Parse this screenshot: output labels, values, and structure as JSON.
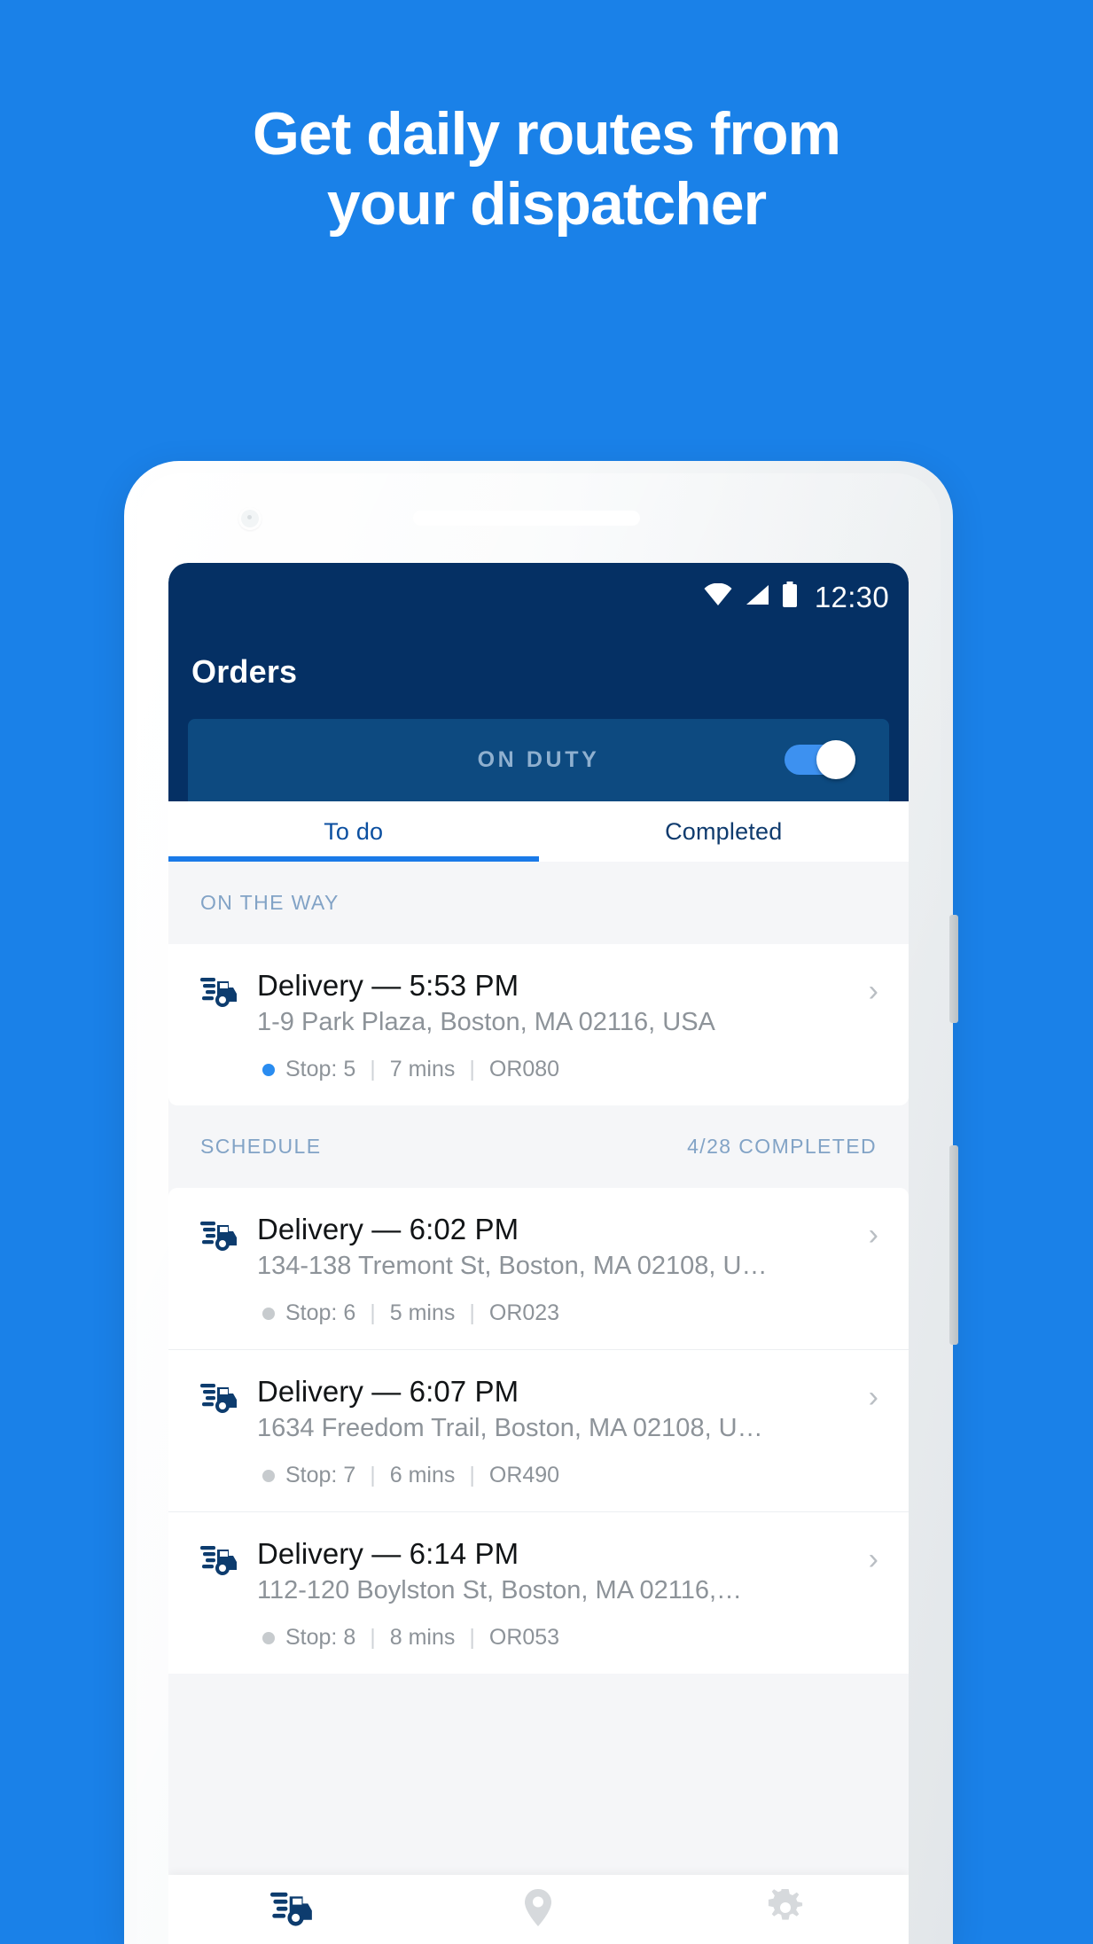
{
  "promo": {
    "headline_line1": "Get daily routes from",
    "headline_line2": "your dispatcher",
    "background_color": "#1a81e8",
    "text_color": "#ffffff"
  },
  "statusbar": {
    "wifi_icon": "wifi-icon",
    "signal_icon": "cellular-signal-icon",
    "battery_icon": "battery-full-icon",
    "time": "12:30"
  },
  "appbar": {
    "title": "Orders",
    "background_color": "#053064",
    "duty": {
      "label": "ON DUTY",
      "toggle_state": "on",
      "bar_color": "#0d4a80",
      "accent_color": "#3d91f0"
    }
  },
  "tabs": {
    "active_index": 0,
    "indicator_color": "#1a7ae8",
    "items": [
      {
        "label": "To do"
      },
      {
        "label": "Completed"
      }
    ]
  },
  "sections": [
    {
      "label": "ON THE WAY",
      "right_label": "",
      "orders": [
        {
          "icon": "delivery-truck-icon",
          "title": "Delivery — 5:53 PM",
          "address": "1-9 Park Plaza, Boston, MA 02116, USA",
          "stop": "Stop: 5",
          "duration": "7 mins",
          "order_id": "OR080",
          "dot_state": "active",
          "chevron": "›"
        }
      ]
    },
    {
      "label": "SCHEDULE",
      "right_label": "4/28 COMPLETED",
      "orders": [
        {
          "icon": "delivery-truck-icon",
          "title": "Delivery — 6:02 PM",
          "address": "134-138 Tremont St, Boston, MA 02108, U…",
          "stop": "Stop: 6",
          "duration": "5 mins",
          "order_id": "OR023",
          "dot_state": "inactive",
          "chevron": "›"
        },
        {
          "icon": "delivery-truck-icon",
          "title": "Delivery — 6:07 PM",
          "address": "1634 Freedom Trail, Boston, MA 02108, U…",
          "stop": "Stop: 7",
          "duration": "6 mins",
          "order_id": "OR490",
          "dot_state": "inactive",
          "chevron": "›"
        },
        {
          "icon": "delivery-truck-icon",
          "title": "Delivery — 6:14 PM",
          "address": "112-120 Boylston St, Boston, MA 02116,…",
          "stop": "Stop: 8",
          "duration": "8 mins",
          "order_id": "OR053",
          "dot_state": "inactive",
          "chevron": "›"
        }
      ]
    }
  ],
  "separators": {
    "pipe": "|"
  },
  "bottom_nav": {
    "active_index": 0,
    "items": [
      {
        "icon": "delivery-truck-icon",
        "state": "active"
      },
      {
        "icon": "location-pin-icon",
        "state": "inactive"
      },
      {
        "icon": "gear-icon",
        "state": "inactive"
      }
    ]
  }
}
